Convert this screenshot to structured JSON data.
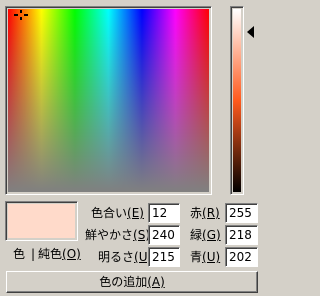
{
  "colors": {
    "selected": "#ffdaca",
    "dialog_bg": "#d4d0c8"
  },
  "preview": {
    "color_label": "色",
    "separator": "|",
    "solid_label": "純色",
    "solid_mnemonic": "(O)"
  },
  "hsl": {
    "hue_label": "色合い",
    "hue_mnemonic": "(E)",
    "hue_value": "12",
    "sat_label": "鮮やかさ",
    "sat_mnemonic": "(S)",
    "sat_value": "240",
    "lum_label": "明るさ",
    "lum_mnemonic": "(U)",
    "lum_value": "215"
  },
  "rgb": {
    "red_label": "赤",
    "red_mnemonic": "(R)",
    "red_value": "255",
    "green_label": "緑",
    "green_mnemonic": "(G)",
    "green_value": "218",
    "blue_label": "青",
    "blue_mnemonic": "(U)",
    "blue_value": "202"
  },
  "actions": {
    "add_label": "色の追加",
    "add_mnemonic": "(A)"
  }
}
